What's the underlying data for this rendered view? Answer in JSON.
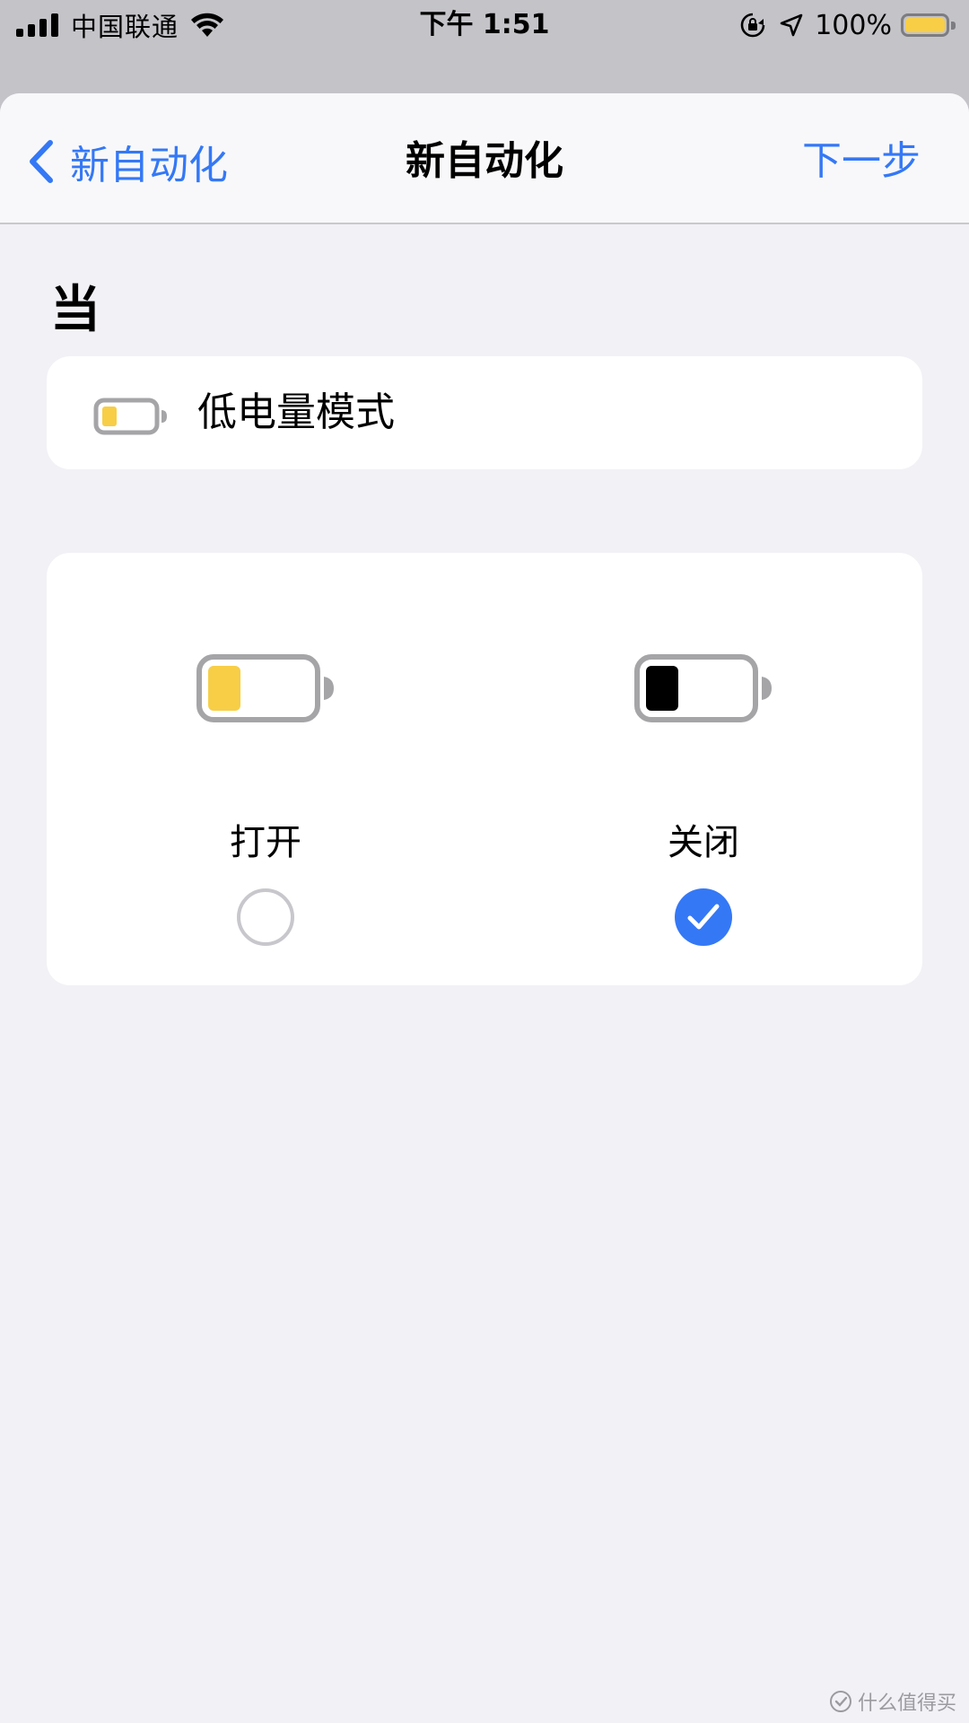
{
  "status_bar": {
    "carrier": "中国联通",
    "time": "下午 1:51",
    "battery_percent": "100%",
    "battery_level": 1.0,
    "battery_fill_color": "#f7ce46"
  },
  "nav": {
    "back_label": "新自动化",
    "title": "新自动化",
    "next_label": "下一步",
    "accent_color": "#3478f6"
  },
  "section_title": "当",
  "trigger": {
    "label": "低电量模式",
    "icon": "low-battery-icon"
  },
  "options": [
    {
      "label": "打开",
      "icon": "battery-low-power-icon",
      "selected": false
    },
    {
      "label": "关闭",
      "icon": "battery-normal-icon",
      "selected": true
    }
  ],
  "watermark": {
    "text": "什么值得买"
  }
}
